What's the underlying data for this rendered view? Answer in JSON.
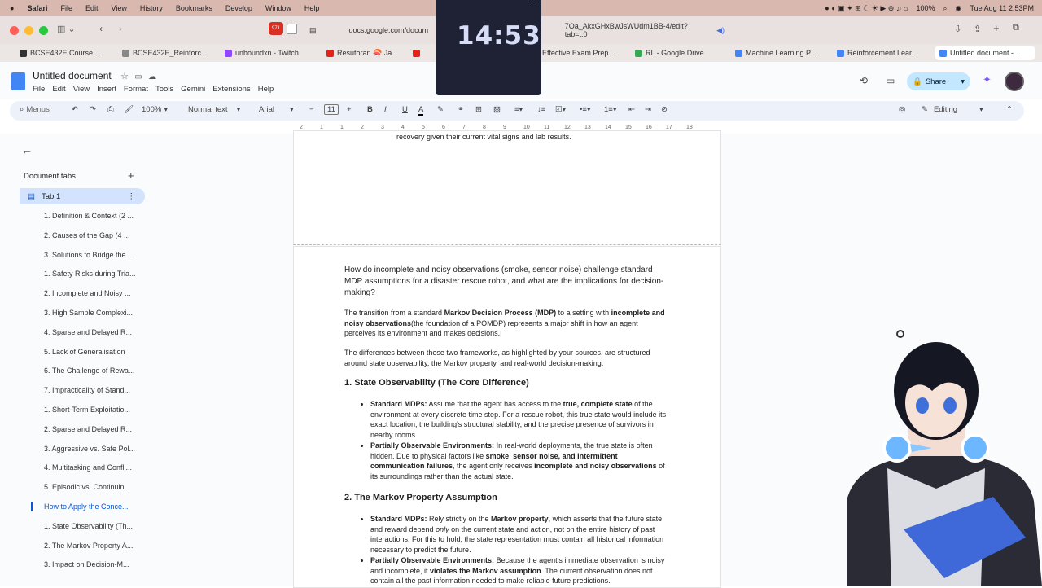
{
  "macbar": {
    "apple": "",
    "app": "Safari",
    "menus": [
      "File",
      "Edit",
      "View",
      "History",
      "Bookmarks",
      "Develop",
      "Window",
      "Help"
    ],
    "battery": "100%",
    "datetime": "Tue Aug 11  2:53PM"
  },
  "browser": {
    "address": "docs.google.com/docum",
    "address_tail": "7Oa_AkxGHxBwJsWUdm1BB-4/edit?tab=t.0",
    "badge": "971"
  },
  "tabs": [
    {
      "label": "BCSE432E Course...",
      "color": "#333"
    },
    {
      "label": "BCSE432E_Reinforc...",
      "color": "#777"
    },
    {
      "label": "unboundxn - Twitch",
      "color": "#9146ff"
    },
    {
      "label": "Resutoran 🍣 Ja...",
      "color": "#e62117"
    },
    {
      "label": "Effective Exam Prep...",
      "color": "#777"
    },
    {
      "label": "RL - Google Drive",
      "color": "#34a853"
    },
    {
      "label": "Machine Learning P...",
      "color": "#4285f4"
    },
    {
      "label": "Reinforcement Lear...",
      "color": "#4285f4"
    },
    {
      "label": "Untitled document -...",
      "color": "#4285f4"
    }
  ],
  "doc": {
    "title": "Untitled document",
    "menus": [
      "File",
      "Edit",
      "View",
      "Insert",
      "Format",
      "Tools",
      "Gemini",
      "Extensions",
      "Help"
    ],
    "share": "Share"
  },
  "toolbar": {
    "search": "Menus",
    "zoom": "100%",
    "style": "Normal text",
    "font": "Arial",
    "size": "11",
    "mode": "Editing"
  },
  "ruler": [
    "2",
    "1",
    "1",
    "2",
    "3",
    "4",
    "5",
    "6",
    "7",
    "8",
    "9",
    "10",
    "11",
    "12",
    "13",
    "14",
    "15",
    "16",
    "17",
    "18"
  ],
  "timer": "14:53",
  "sidebar": {
    "heading": "Document tabs",
    "tab": "Tab 1",
    "outline": [
      "1. Definition & Context (2 ...",
      "2. Causes of the Gap (4 ...",
      "3. Solutions to Bridge the...",
      "1. Safety Risks during Tria...",
      "2. Incomplete and Noisy ...",
      "3. High Sample Complexi...",
      "4. Sparse and Delayed R...",
      "5. Lack of Generalisation",
      "6. The Challenge of Rewa...",
      "7. Impracticality of Stand...",
      "1. Short-Term Exploitatio...",
      "2. Sparse and Delayed R...",
      "3. Aggressive vs. Safe Pol...",
      "4. Multitasking and Confli...",
      "5. Episodic vs. Continuin...",
      "How to Apply the Conce...",
      "1. State Observability (Th...",
      "2. The Markov Property A...",
      "3. Impact on Decision-M..."
    ]
  },
  "content": {
    "prev_tail": "recovery given their current vital signs and lab results.",
    "question": "How do incomplete and noisy observations (smoke, sensor noise) challenge standard MDP assumptions for a disaster rescue robot, and what are the implications for decision-making?",
    "p1a": "The transition from a standard ",
    "p1b": "Markov Decision Process (MDP)",
    "p1c": " to a setting with ",
    "p1d": "incomplete and noisy observations",
    "p1e": "(the foundation of a POMDP) represents a major shift in how an agent perceives its environment and makes decisions.",
    "p2": "The differences between these two frameworks, as highlighted by your sources, are structured around state observability, the Markov property, and real-world decision-making:",
    "h1": "1. State Observability (The Core Difference)",
    "b1a": "Standard MDPs:",
    "b1b": " Assume that the agent has access to the ",
    "b1c": "true, complete state",
    "b1d": " of the environment at every discrete time step. For a rescue robot, this true state would include its exact location, the building's structural stability, and the precise presence of survivors in nearby rooms.",
    "b2a": "Partially Observable Environments:",
    "b2b": " In real-world deployments, the true state is often hidden. Due to physical factors like ",
    "b2c": "smoke",
    "b2d": ", ",
    "b2e": "sensor noise, and intermittent communication failures",
    "b2f": ", the agent only receives ",
    "b2g": "incomplete and noisy observations",
    "b2h": " of its surroundings rather than the actual state.",
    "h2": "2. The Markov Property Assumption",
    "b3a": "Standard MDPs:",
    "b3b": " Rely strictly on the ",
    "b3c": "Markov property",
    "b3d": ", which asserts that the future state and reward depend ",
    "b3e": "only",
    "b3f": " on the current state and action, not on the entire history of past interactions. For this to hold, the state representation must contain all historical information necessary to predict the future.",
    "b4a": "Partially Observable Environments:",
    "b4b": " Because the agent's immediate observation is noisy and incomplete, it ",
    "b4c": "violates the Markov assumption",
    "b4d": ". The current observation does not contain all the past information needed to make reliable future predictions."
  }
}
